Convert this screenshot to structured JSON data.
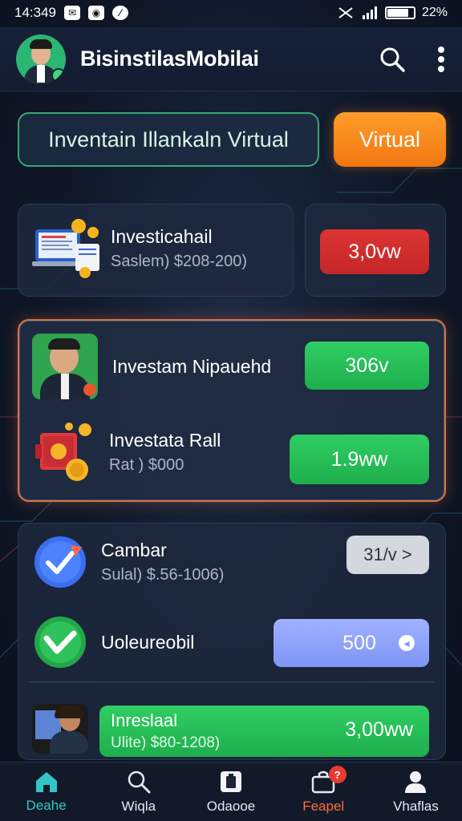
{
  "status_bar": {
    "time": "14:349",
    "icons": [
      "notification-icon",
      "message-icon",
      "no-disturb-icon"
    ],
    "battery_level": 0.8,
    "battery_text": "22%"
  },
  "app_bar": {
    "title": "BisinstilasMobilai",
    "search_icon": "search-icon",
    "more_icon": "more-vertical-icon"
  },
  "toggle": {
    "left_label": "Inventain Illankaln Virtual",
    "right_label": "Virtual"
  },
  "card1": {
    "title": "Investicahail",
    "subtitle": "Saslem) $208-200)",
    "value": "3,0vw",
    "value_color": "#d12c2c"
  },
  "card2": {
    "items": [
      {
        "title": "Investam Nipauehd",
        "subtitle": "",
        "value": "306v"
      },
      {
        "title": "Investata Rall",
        "subtitle": "Rat ) $000",
        "value": "1.9ww"
      }
    ]
  },
  "card3": {
    "items": [
      {
        "title": "Cambar",
        "subtitle": "Sulal) $.56-1006)",
        "value": "31/v >"
      },
      {
        "title": "Uoleureobil",
        "subtitle": "",
        "value": "500"
      },
      {
        "title": "Inreslaal",
        "subtitle": "Ulite) $80-1208)",
        "value": "3,00ww"
      }
    ]
  },
  "bottom_nav": {
    "items": [
      {
        "label": "Deahe",
        "icon": "home-icon"
      },
      {
        "label": "Wiqla",
        "icon": "search-icon"
      },
      {
        "label": "Odaooe",
        "icon": "wallet-icon"
      },
      {
        "label": "Feapel",
        "icon": "bag-icon",
        "badge": "?"
      },
      {
        "label": "Vhaflas",
        "icon": "profile-icon"
      }
    ]
  }
}
